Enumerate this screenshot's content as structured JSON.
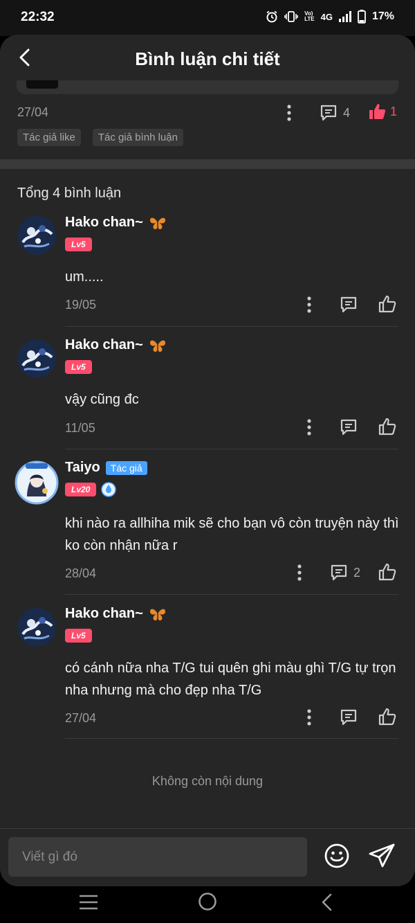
{
  "status_bar": {
    "time": "22:32",
    "network": "4G",
    "volte_top": "Vo)",
    "volte_bottom": "LTE",
    "battery": "17%"
  },
  "header": {
    "title": "Bình luận chi tiết"
  },
  "post": {
    "date": "27/04",
    "comment_count": "4",
    "like_count": "1",
    "tags": [
      "Tác giả like",
      "Tác giả bình luận"
    ]
  },
  "comments_total": "Tổng 4 bình luận",
  "comments": [
    {
      "author": "Hako chan~",
      "level": "Lv5",
      "text": "um.....",
      "date": "19/05",
      "reply_count": ""
    },
    {
      "author": "Hako chan~",
      "level": "Lv5",
      "text": "vậy cũng đc",
      "date": "11/05",
      "reply_count": ""
    },
    {
      "author": "Taiyo",
      "author_badge": "Tác giả",
      "level": "Lv20",
      "text": "khi nào ra allhiha mik sẽ cho bạn vô còn truyện này thì ko còn nhận nữa r",
      "date": "28/04",
      "reply_count": "2"
    },
    {
      "author": "Hako chan~",
      "level": "Lv5",
      "text": "có cánh nữa nha T/G tui quên ghi màu ghì T/G tự trọn nha nhưng mà cho đẹp nha T/G",
      "date": "27/04",
      "reply_count": ""
    }
  ],
  "end_label": "Không còn nội dung",
  "composer": {
    "placeholder": "Viết gì đó"
  },
  "colors": {
    "accent_red": "#ff4d6d",
    "author_blue": "#4aa3ff",
    "background": "#262626"
  }
}
